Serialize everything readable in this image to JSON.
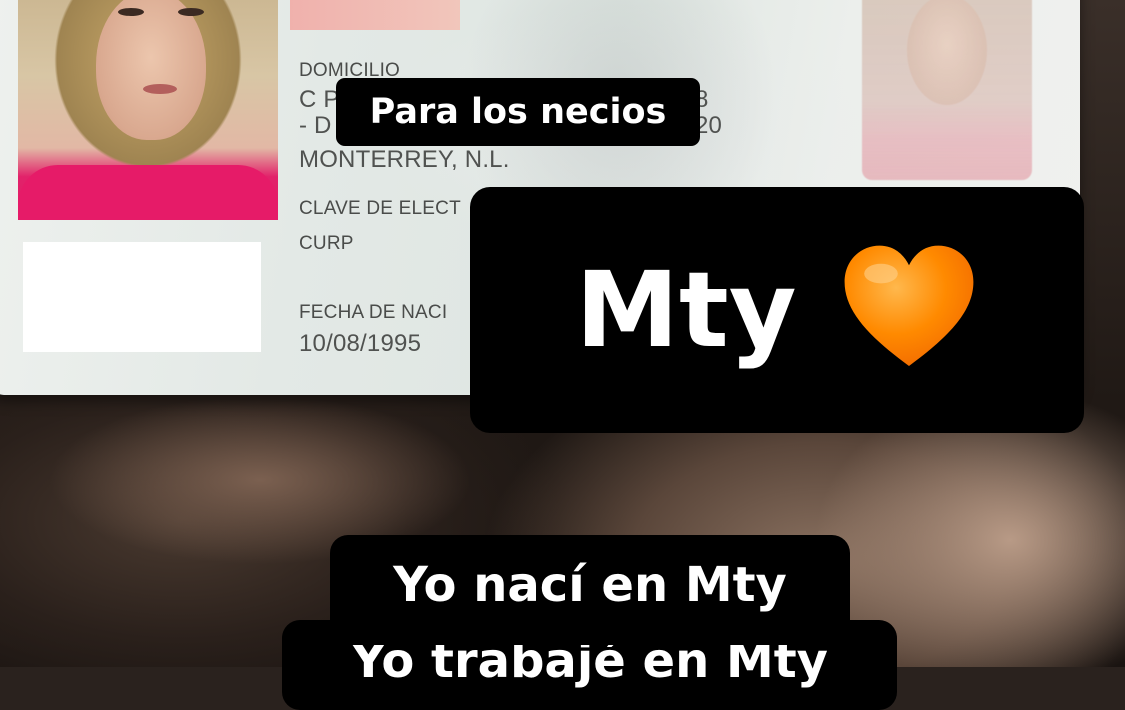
{
  "id_card": {
    "domicilio_label": "DOMICILIO",
    "address_line1": "C P",
    "address_line2": "- D",
    "address_line1_tail": "8",
    "address_line2_tail": "20",
    "city": "MONTERREY, N.L.",
    "clave_label": "CLAVE DE ELECT",
    "curp_label": "CURP",
    "fecha_label": "FECHA DE NACI",
    "fecha_value": "10/08/1995"
  },
  "captions": {
    "small": "Para los necios",
    "big": "Mty",
    "line1": "Yo nací en Mty",
    "line2": "Yo trabajé en Mty"
  },
  "emoji": {
    "icon": "orange-heart",
    "color": "#FF8A00"
  }
}
